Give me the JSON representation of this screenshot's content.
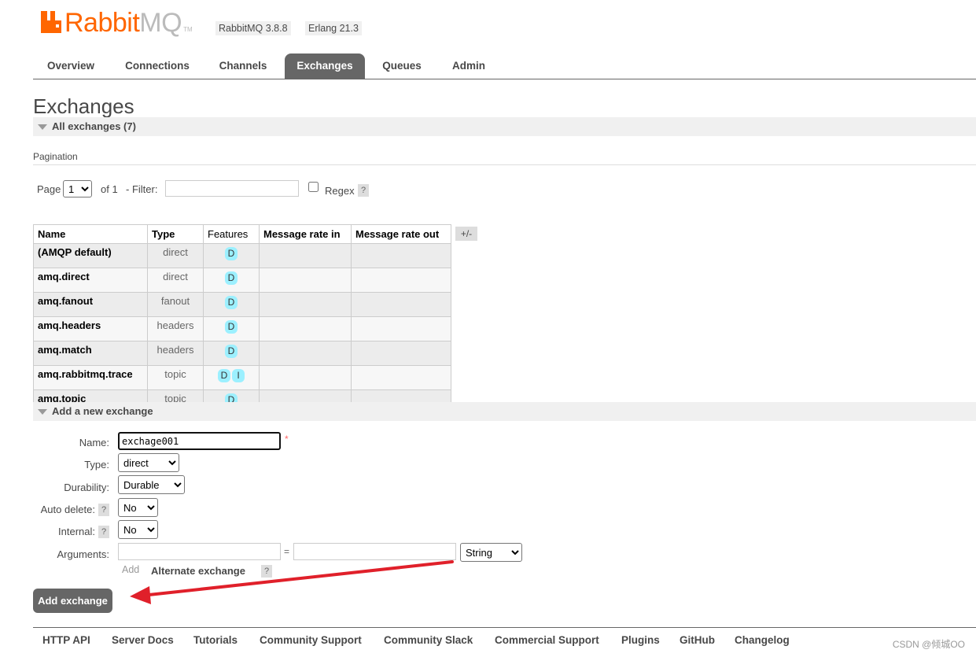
{
  "app": {
    "logo_word": "Rabbit",
    "logo_mq": "MQ",
    "logo_tm": "TM",
    "version_rabbitmq": "RabbitMQ 3.8.8",
    "version_erlang": "Erlang 21.3",
    "brand_color": "#ff6600"
  },
  "tabs": [
    {
      "label": "Overview",
      "active": false
    },
    {
      "label": "Connections",
      "active": false
    },
    {
      "label": "Channels",
      "active": false
    },
    {
      "label": "Exchanges",
      "active": true
    },
    {
      "label": "Queues",
      "active": false
    },
    {
      "label": "Admin",
      "active": false
    }
  ],
  "page": {
    "title": "Exchanges",
    "all_exchanges_label": "All exchanges (7)",
    "pagination_label": "Pagination"
  },
  "pagination": {
    "page_label": "Page",
    "page_value": "1",
    "of_label": "of 1",
    "filter_label": "- Filter:",
    "filter_value": "",
    "regex_label": "Regex",
    "regex_checked": false,
    "help": "?"
  },
  "table": {
    "headers": {
      "name": "Name",
      "type": "Type",
      "features": "Features",
      "rate_in": "Message rate in",
      "rate_out": "Message rate out"
    },
    "toggle_columns": "+/-",
    "rows": [
      {
        "name": "(AMQP default)",
        "type": "direct",
        "features": [
          "D"
        ],
        "rate_in": "",
        "rate_out": ""
      },
      {
        "name": "amq.direct",
        "type": "direct",
        "features": [
          "D"
        ],
        "rate_in": "",
        "rate_out": ""
      },
      {
        "name": "amq.fanout",
        "type": "fanout",
        "features": [
          "D"
        ],
        "rate_in": "",
        "rate_out": ""
      },
      {
        "name": "amq.headers",
        "type": "headers",
        "features": [
          "D"
        ],
        "rate_in": "",
        "rate_out": ""
      },
      {
        "name": "amq.match",
        "type": "headers",
        "features": [
          "D"
        ],
        "rate_in": "",
        "rate_out": ""
      },
      {
        "name": "amq.rabbitmq.trace",
        "type": "topic",
        "features": [
          "D",
          "I"
        ],
        "rate_in": "",
        "rate_out": ""
      },
      {
        "name": "amq.topic",
        "type": "topic",
        "features": [
          "D"
        ],
        "rate_in": "",
        "rate_out": ""
      }
    ]
  },
  "add_exchange": {
    "section_title": "Add a new exchange",
    "name_label": "Name:",
    "name_value": "exchage001",
    "required_mark": "*",
    "type_label": "Type:",
    "type_value": "direct",
    "durability_label": "Durability:",
    "durability_value": "Durable",
    "auto_delete_label": "Auto delete:",
    "auto_delete_value": "No",
    "internal_label": "Internal:",
    "internal_value": "No",
    "arguments_label": "Arguments:",
    "argument_key": "",
    "equals": "=",
    "argument_value": "",
    "argument_type": "String",
    "add_link": "Add",
    "alternate_exchange": "Alternate exchange",
    "help": "?",
    "submit_label": "Add exchange"
  },
  "footer": {
    "links": [
      "HTTP API",
      "Server Docs",
      "Tutorials",
      "Community Support",
      "Community Slack",
      "Commercial Support",
      "Plugins",
      "GitHub",
      "Changelog"
    ],
    "watermark": "CSDN @倾城OO"
  },
  "annotation": {
    "arrow_color": "#e0202a"
  }
}
